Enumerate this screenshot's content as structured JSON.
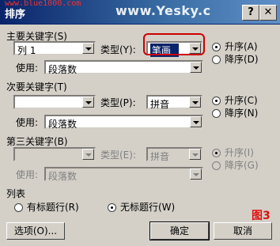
{
  "window": {
    "title": "排序",
    "watermark_left": "www.blue1000.com",
    "watermark_right": "www.Yesky.c",
    "icon": "help-question-icon",
    "close_icon": "close-x-icon"
  },
  "primary": {
    "heading": "主要关键字(S)",
    "field_value": "列 1",
    "type_label": "类型(Y):",
    "type_value": "笔画",
    "using_label": "使用:",
    "using_value": "段落数",
    "asc_label": "升序(A)",
    "desc_label": "降序(D)"
  },
  "secondary": {
    "heading": "次要关键字(T)",
    "field_value": "",
    "type_label": "类型(P):",
    "type_value": "拼音",
    "using_label": "使用:",
    "using_value": "段落数",
    "asc_label": "升序(C)",
    "desc_label": "降序(N)"
  },
  "tertiary": {
    "heading": "第三关键字(B)",
    "field_value": "",
    "type_label": "类型(E):",
    "type_value": "拼音",
    "using_label": "使用:",
    "using_value": "段落数",
    "asc_label": "升序(I)",
    "desc_label": "降序(G)"
  },
  "list": {
    "heading": "列表",
    "header_row_label": "有标题行(R)",
    "no_header_row_label": "无标题行(W)"
  },
  "buttons": {
    "options": "选项(O)...",
    "ok": "确定",
    "cancel": "取消"
  },
  "figure_label": "图3"
}
